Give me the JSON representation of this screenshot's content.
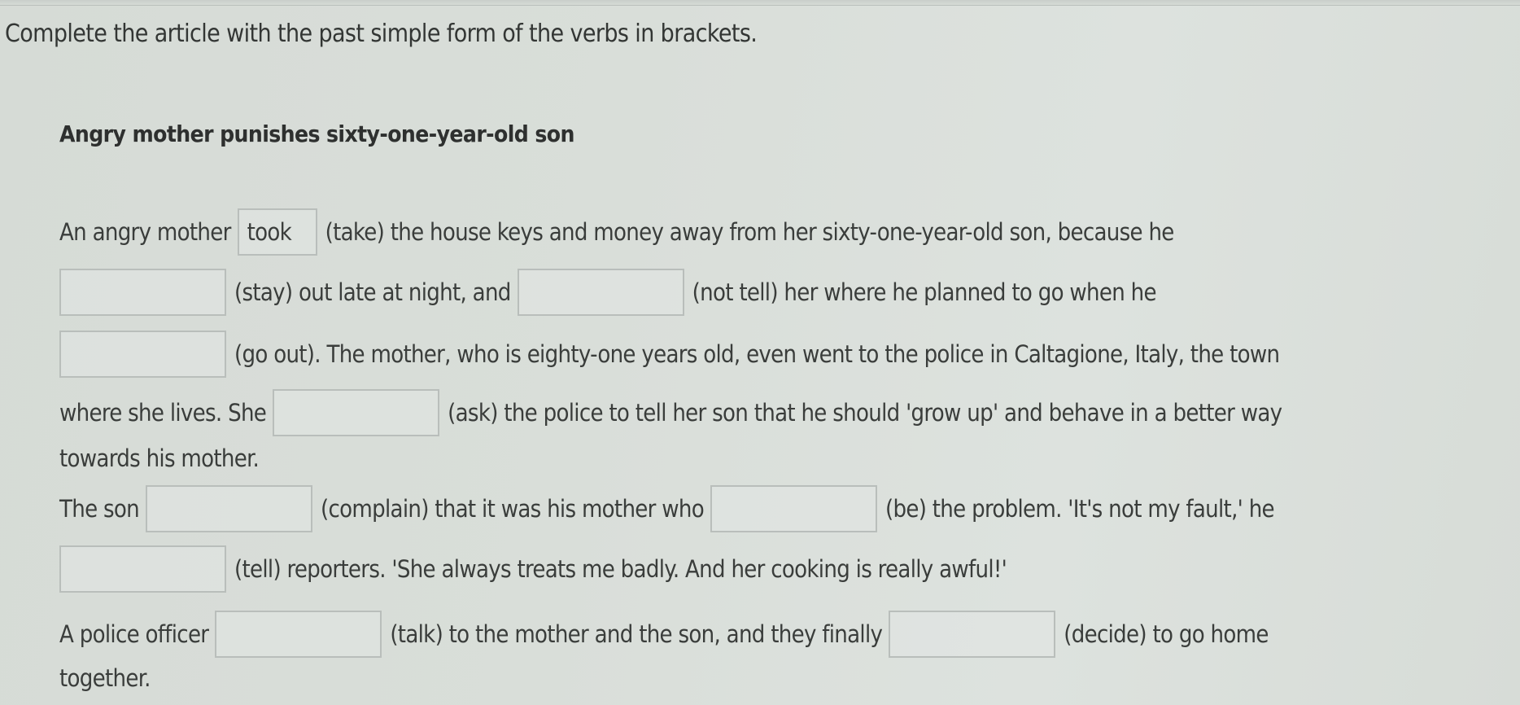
{
  "instruction": "Complete the article with the past simple form of the verbs in brackets.",
  "article_title": "Angry mother punishes sixty-one-year-old son",
  "lines": {
    "l1": {
      "pre": "An angry mother",
      "post": "(take) the house keys and money away from her sixty-one-year-old son, because he"
    },
    "l2": {
      "mid": "(stay) out late at night, and",
      "post": "(not tell) her where he planned to go when he"
    },
    "l3": {
      "post": "(go out). The mother, who is eighty-one years old, even went to the police in Caltagione, Italy, the town"
    },
    "l4": {
      "pre": "where she lives. She",
      "post": "(ask) the police to tell her son that he should 'grow up' and behave in a better way"
    },
    "l5": {
      "text": "towards his mother."
    },
    "l6": {
      "pre": "The son",
      "mid": "(complain) that it was his mother who",
      "post": "(be) the problem. 'It's not my fault,' he"
    },
    "l7": {
      "post": "(tell) reporters. 'She always treats me badly. And her cooking is really awful!'"
    },
    "l8": {
      "pre": "A police officer",
      "mid": "(talk) to the mother and the son, and they finally",
      "post": "(decide) to go home"
    },
    "l9": {
      "text": "together."
    }
  },
  "gaps": [
    {
      "verb": "take",
      "value": "took"
    },
    {
      "verb": "stay",
      "value": ""
    },
    {
      "verb": "not tell",
      "value": ""
    },
    {
      "verb": "go out",
      "value": ""
    },
    {
      "verb": "ask",
      "value": ""
    },
    {
      "verb": "complain",
      "value": ""
    },
    {
      "verb": "be",
      "value": ""
    },
    {
      "verb": "tell",
      "value": ""
    },
    {
      "verb": "talk",
      "value": ""
    },
    {
      "verb": "decide",
      "value": ""
    }
  ]
}
